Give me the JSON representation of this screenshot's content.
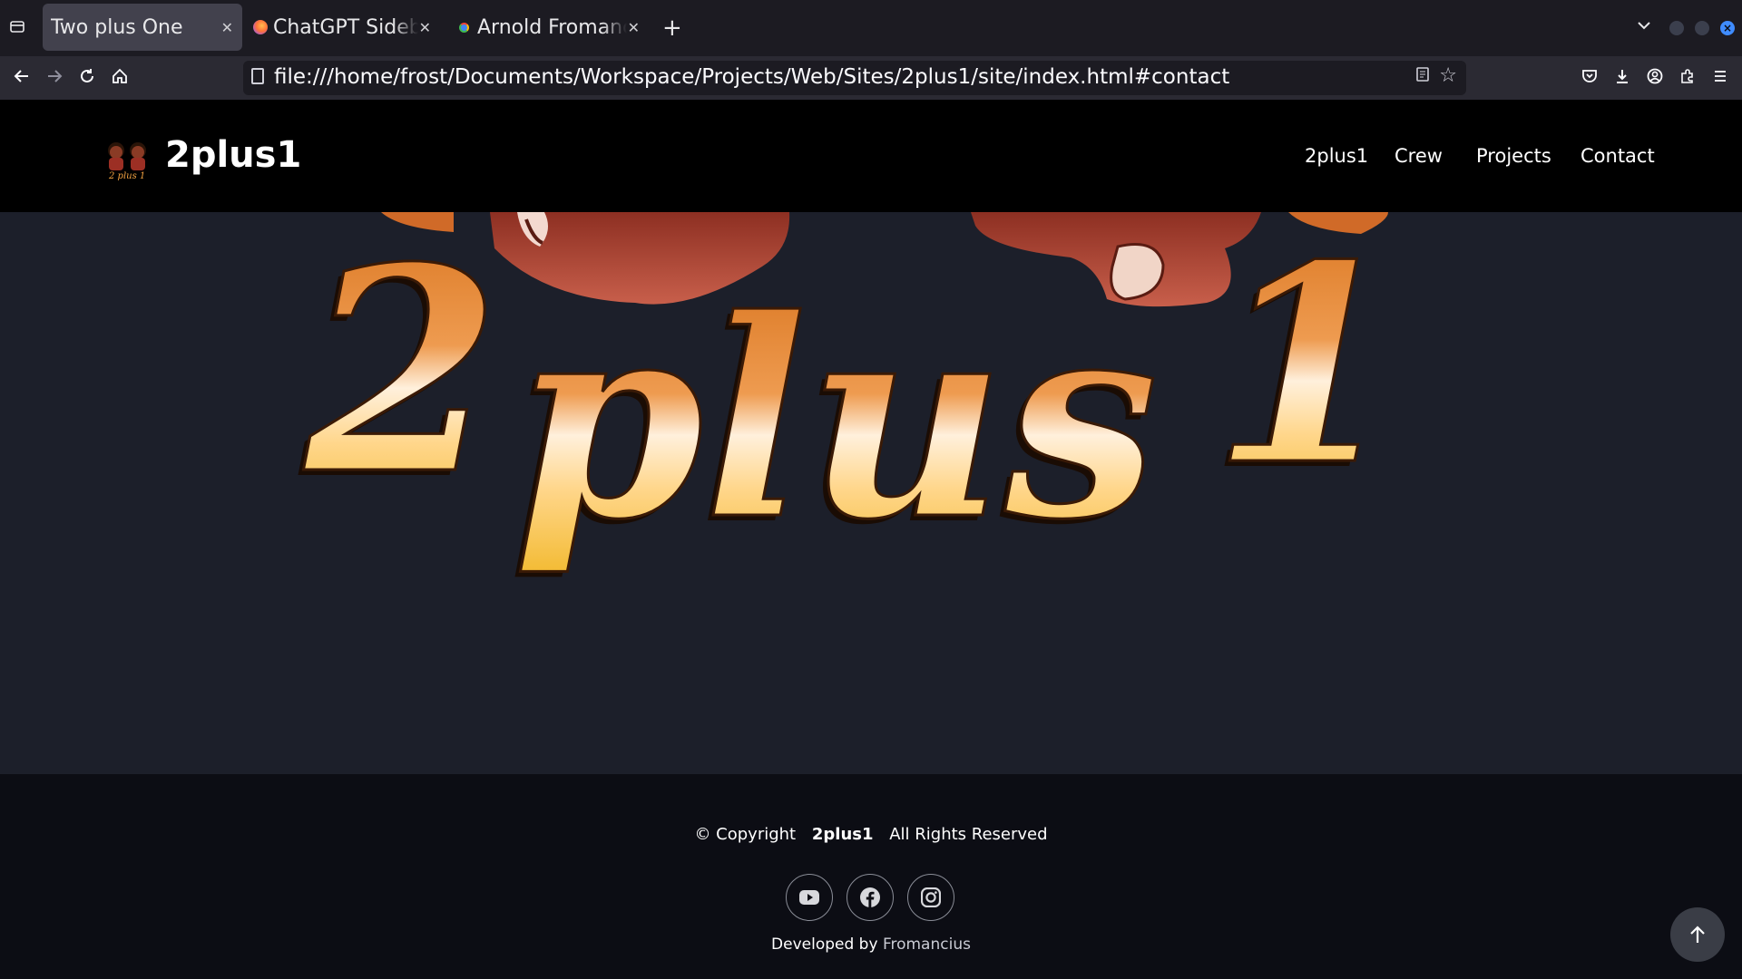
{
  "browser": {
    "tabs": [
      {
        "title": "Two plus One",
        "active": true
      },
      {
        "title": "ChatGPT Sidebar",
        "active": false
      },
      {
        "title": "Arnold Fromancius",
        "active": false
      }
    ],
    "url": "file:///home/frost/Documents/Workspace/Projects/Web/Sites/2plus1/site/index.html#contact",
    "icons": {
      "tab_list": "tab-list-icon",
      "close": "close-icon",
      "new_tab": "plus-icon",
      "overflow": "chevron-down-icon",
      "back": "arrow-left-icon",
      "forward": "arrow-right-icon",
      "reload": "reload-icon",
      "home": "home-icon",
      "reader": "reader-view-icon",
      "bookmark": "star-icon",
      "pocket": "pocket-icon",
      "downloads": "download-icon",
      "account": "account-icon",
      "extensions": "extensions-icon",
      "menu": "hamburger-menu-icon"
    }
  },
  "site": {
    "brand": "2plus1",
    "nav": [
      "2plus1",
      "Crew",
      "Projects",
      "Contact"
    ],
    "hero_logo_text": "2 plus 1",
    "footer": {
      "copyright_prefix": "© Copyright",
      "copyright_brand": "2plus1",
      "copyright_suffix": "All Rights Reserved",
      "socials": [
        "youtube-icon",
        "facebook-icon",
        "instagram-icon"
      ],
      "developed_by": "Developed by",
      "developer": "Fromancius"
    }
  },
  "colors": {
    "header_bg": "#000000",
    "hero_bg": "#1c1f2a",
    "footer_bg": "#0c0d14",
    "logo_orange": "#e08a2c",
    "logo_cream": "#ffe9c8",
    "logo_gold": "#f5c23c"
  }
}
